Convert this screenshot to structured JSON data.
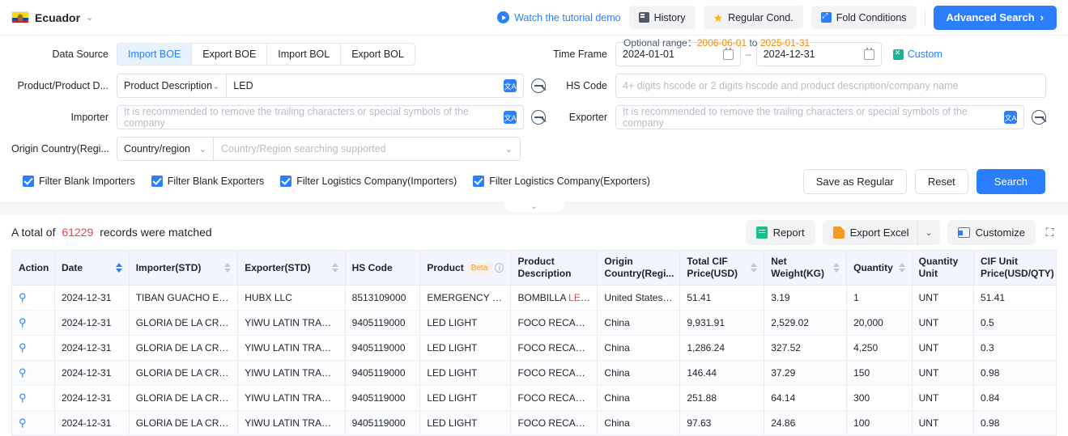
{
  "topbar": {
    "country": "Ecuador",
    "tutorial_label": "Watch the tutorial demo",
    "history_label": "History",
    "regular_label": "Regular Cond.",
    "fold_label": "Fold Conditions",
    "advanced_label": "Advanced Search",
    "advanced_caret": "›"
  },
  "form": {
    "data_source_label": "Data Source",
    "data_source_tabs": [
      "Import BOE",
      "Export BOE",
      "Import BOL",
      "Export BOL"
    ],
    "data_source_active": "Import BOE",
    "optional_range_label": "Optional range：",
    "optional_range_from": "2006-06-01",
    "optional_range_to_word": " to ",
    "optional_range_to": "2025-01-31",
    "time_frame_label": "Time Frame",
    "date_from": "2024-01-01",
    "date_to": "2024-12-31",
    "date_separator": "–",
    "custom_label": "Custom",
    "product_label": "Product/Product D...",
    "product_select": "Product Description",
    "product_value": "LED",
    "hs_code_label": "HS Code",
    "hs_code_placeholder": "4+ digits hscode or 2 digits hscode and product description/company name",
    "importer_label": "Importer",
    "importer_placeholder": "It is recommended to remove the trailing characters or special symbols of the company",
    "exporter_label": "Exporter",
    "exporter_placeholder": "It is recommended to remove the trailing characters or special symbols of the company",
    "origin_label": "Origin Country(Regi...",
    "origin_select": "Country/region",
    "origin_placeholder": "Country/Region searching supported",
    "checkboxes": [
      {
        "label": "Filter Blank Importers",
        "checked": true
      },
      {
        "label": "Filter Blank Exporters",
        "checked": true
      },
      {
        "label": "Filter Logistics Company(Importers)",
        "checked": true
      },
      {
        "label": "Filter Logistics Company(Exporters)",
        "checked": true
      }
    ],
    "save_regular_label": "Save as Regular",
    "reset_label": "Reset",
    "search_label": "Search",
    "collapse_caret": "⌄"
  },
  "results": {
    "total_prefix": "A total of",
    "total_count": "61229",
    "total_suffix": "records were matched",
    "report_label": "Report",
    "export_label": "Export Excel",
    "export_caret": "⌄",
    "customize_label": "Customize",
    "expand_icon": "⛶"
  },
  "table": {
    "columns": [
      {
        "label": "Action",
        "sortable": false
      },
      {
        "label": "Date",
        "sortable": true,
        "sort_active": true
      },
      {
        "label": "Importer(STD)",
        "sortable": true
      },
      {
        "label": "Exporter(STD)",
        "sortable": true
      },
      {
        "label": "HS Code",
        "sortable": false
      },
      {
        "label": "Product",
        "badge": "Beta",
        "info": "i",
        "sortable": false
      },
      {
        "label": "Product Description",
        "sortable": false
      },
      {
        "label": "Origin Country(Regi...",
        "sortable": false
      },
      {
        "label": "Total CIF Price(USD)",
        "sortable": true
      },
      {
        "label": "Net Weight(KG)",
        "sortable": true
      },
      {
        "label": "Quantity",
        "sortable": true
      },
      {
        "label": "Quantity Unit",
        "sortable": false
      },
      {
        "label": "CIF Unit Price(USD/QTY)",
        "sortable": false
      }
    ],
    "action_icon": "⌕",
    "rows": [
      {
        "date": "2024-12-31",
        "importer": "TIBAN GUACHO EDI...",
        "exporter": "HUBX LLC",
        "hs_code": "8513109000",
        "product": "EMERGENCY FLA...",
        "description_pre": "BOMBILLA ",
        "description_hl": "LED",
        "description_post": " D...",
        "origin": "United States of",
        "total_cif": "51.41",
        "net_weight": "3.19",
        "quantity": "1",
        "quantity_unit": "UNT",
        "cif_unit": "51.41"
      },
      {
        "date": "2024-12-31",
        "importer": "GLORIA DE LA CRUZ",
        "exporter": "YIWU LATIN TRADE...",
        "hs_code": "9405119000",
        "product": "LED LIGHT",
        "description_pre": "FOCO RECARGA...",
        "description_hl": "",
        "description_post": "",
        "origin": "China",
        "total_cif": "9,931.91",
        "net_weight": "2,529.02",
        "quantity": "20,000",
        "quantity_unit": "UNT",
        "cif_unit": "0.5"
      },
      {
        "date": "2024-12-31",
        "importer": "GLORIA DE LA CRUZ",
        "exporter": "YIWU LATIN TRADE...",
        "hs_code": "9405119000",
        "product": "LED LIGHT",
        "description_pre": "FOCO RECARGA...",
        "description_hl": "",
        "description_post": "",
        "origin": "China",
        "total_cif": "1,286.24",
        "net_weight": "327.52",
        "quantity": "4,250",
        "quantity_unit": "UNT",
        "cif_unit": "0.3"
      },
      {
        "date": "2024-12-31",
        "importer": "GLORIA DE LA CRUZ",
        "exporter": "YIWU LATIN TRADE...",
        "hs_code": "9405119000",
        "product": "LED LIGHT",
        "description_pre": "FOCO RECARGA...",
        "description_hl": "",
        "description_post": "",
        "origin": "China",
        "total_cif": "146.44",
        "net_weight": "37.29",
        "quantity": "150",
        "quantity_unit": "UNT",
        "cif_unit": "0.98"
      },
      {
        "date": "2024-12-31",
        "importer": "GLORIA DE LA CRUZ",
        "exporter": "YIWU LATIN TRADE...",
        "hs_code": "9405119000",
        "product": "LED LIGHT",
        "description_pre": "FOCO RECARGA...",
        "description_hl": "",
        "description_post": "",
        "origin": "China",
        "total_cif": "251.88",
        "net_weight": "64.14",
        "quantity": "300",
        "quantity_unit": "UNT",
        "cif_unit": "0.84"
      },
      {
        "date": "2024-12-31",
        "importer": "GLORIA DE LA CRUZ",
        "exporter": "YIWU LATIN TRADE...",
        "hs_code": "9405119000",
        "product": "LED LIGHT",
        "description_pre": "FOCO RECARGA...",
        "description_hl": "",
        "description_post": "",
        "origin": "China",
        "total_cif": "97.63",
        "net_weight": "24.86",
        "quantity": "100",
        "quantity_unit": "UNT",
        "cif_unit": "0.98"
      }
    ]
  },
  "colors": {
    "accent": "#2b7fff",
    "danger": "#f53f3f",
    "warning": "#ff8800",
    "beta": "#f59a23"
  }
}
